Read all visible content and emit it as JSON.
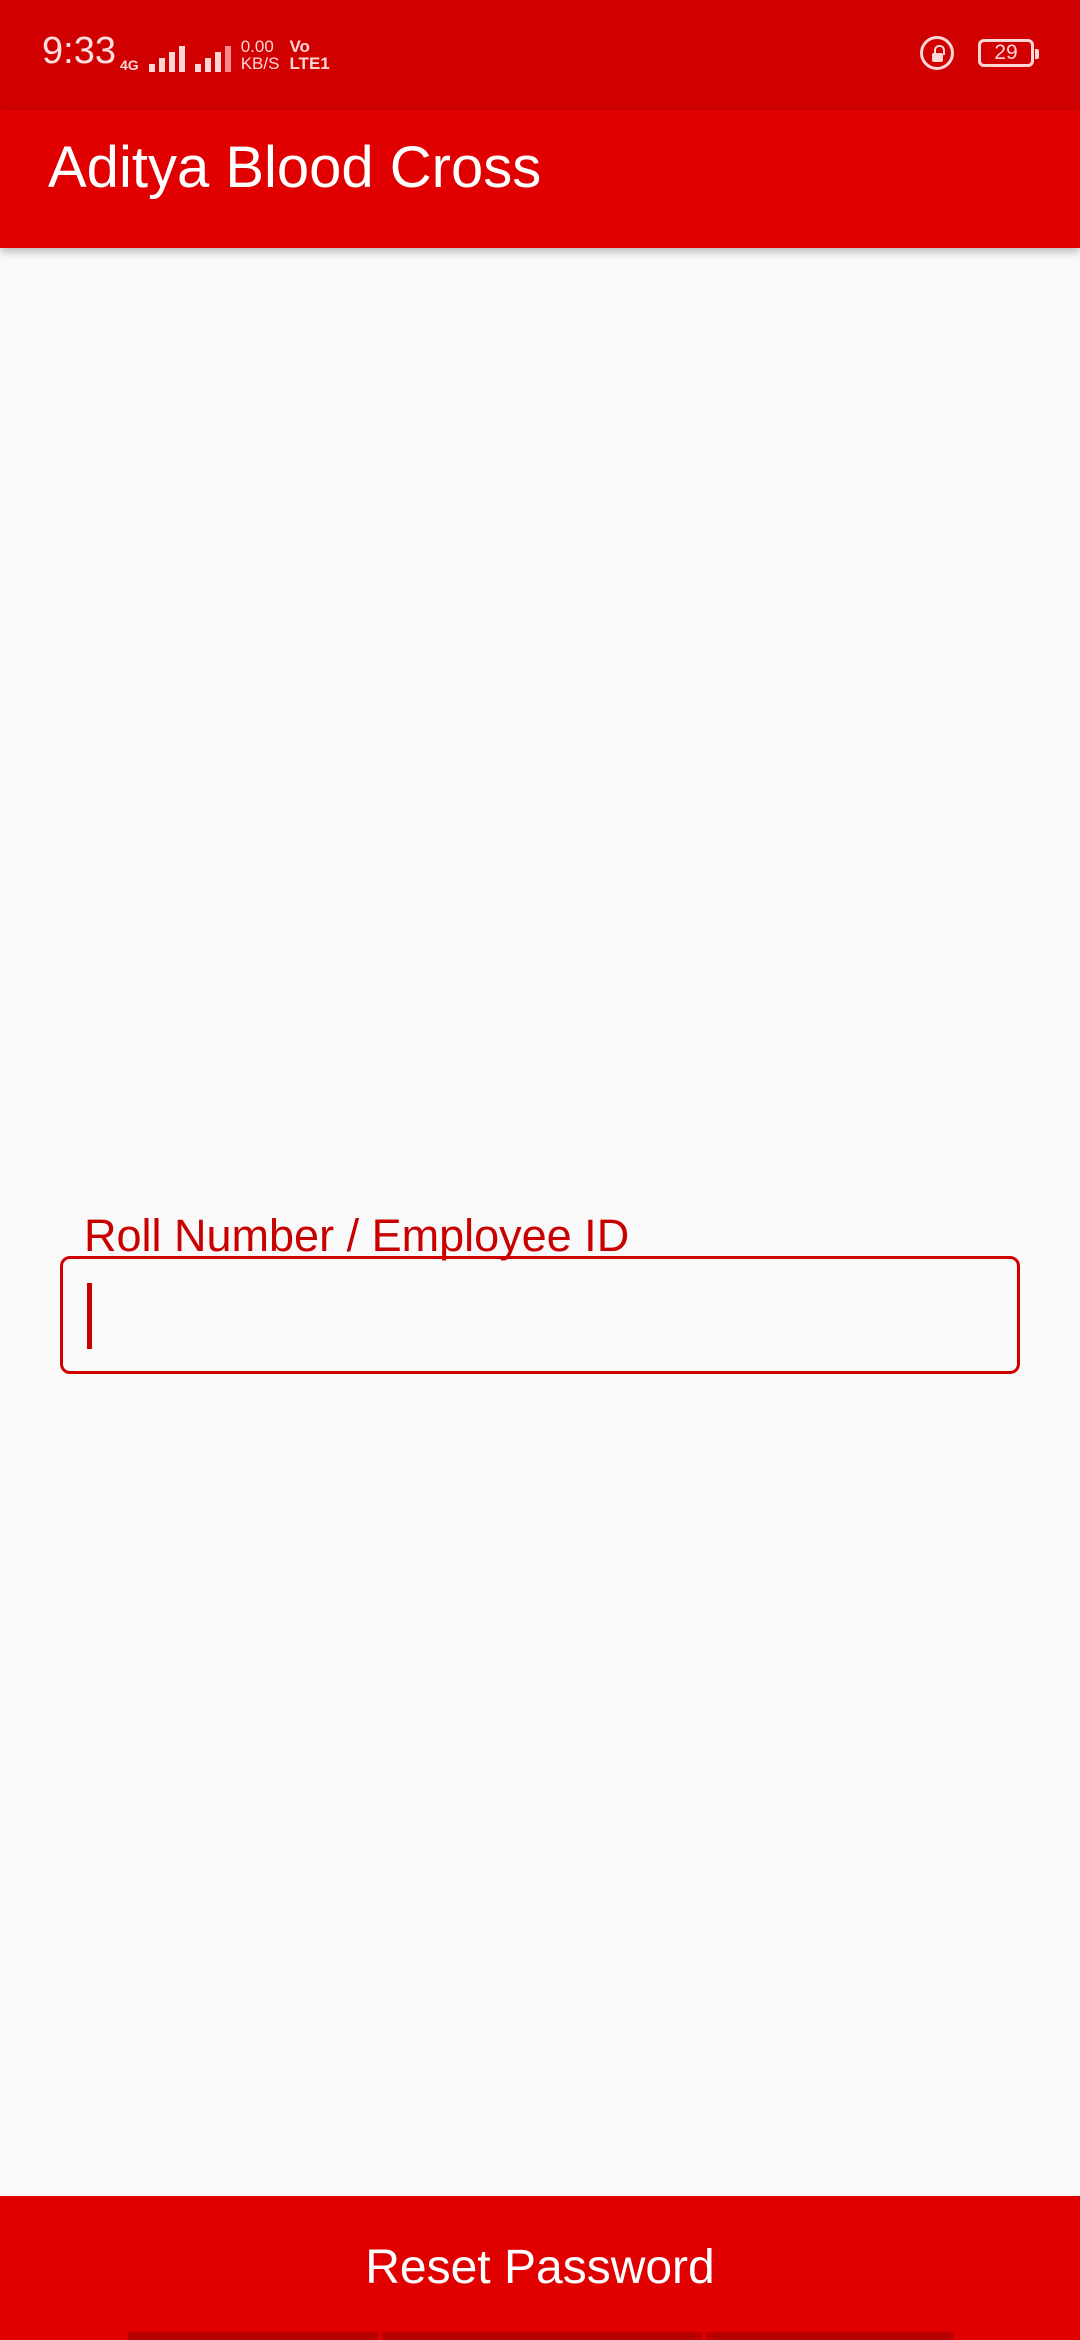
{
  "status_bar": {
    "time": "9:33",
    "network_type": "4G",
    "net_speed_value": "0.00",
    "net_speed_unit": "KB/S",
    "volte_top": "Vo",
    "volte_bottom": "LTE1",
    "battery": "29",
    "icons": [
      "signal-icon",
      "signal-icon",
      "lock-rotation-icon",
      "battery-icon"
    ]
  },
  "app_bar": {
    "title": "Aditya Blood Cross"
  },
  "form": {
    "field_label": "Roll Number / Employee ID",
    "field_value": ""
  },
  "bottom_button": {
    "label": "Reset Password"
  },
  "colors": {
    "primary": "#e00000",
    "status_bar": "#d10000",
    "accent_text": "#c80000",
    "background": "#f9f9f9"
  }
}
